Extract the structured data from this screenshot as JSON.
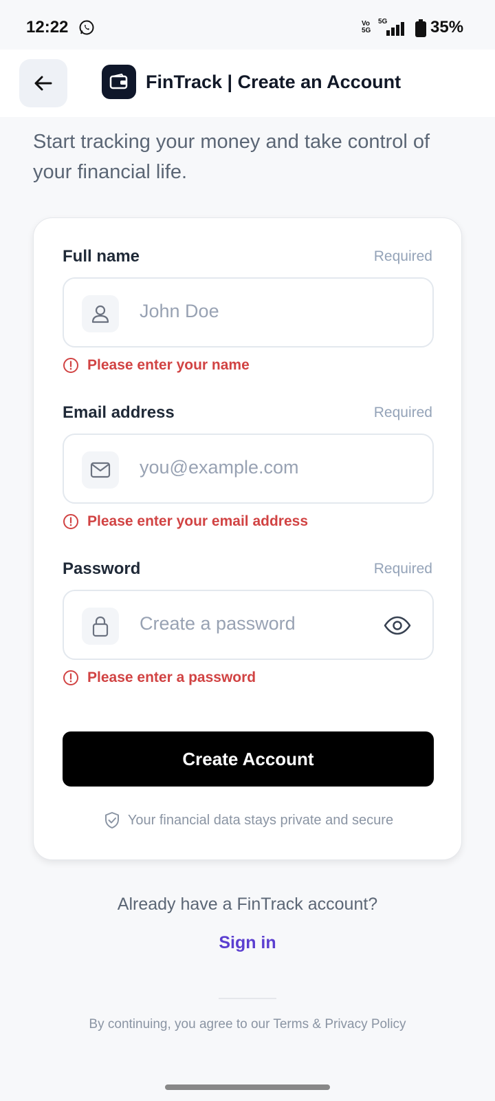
{
  "status_bar": {
    "time": "12:22",
    "network_label": "Vo 5G",
    "signal_label": "5G",
    "battery": "35%"
  },
  "header": {
    "title": "FinTrack | Create an Account"
  },
  "subtitle": "Start tracking your money and take control of your financial life.",
  "form": {
    "fields": [
      {
        "label": "Full name",
        "required": "Required",
        "placeholder": "John Doe",
        "icon": "user-icon",
        "error": "Please enter your name"
      },
      {
        "label": "Email address",
        "required": "Required",
        "placeholder": "you@example.com",
        "icon": "mail-icon",
        "error": "Please enter your email address"
      },
      {
        "label": "Password",
        "required": "Required",
        "placeholder": "Create a password",
        "icon": "lock-icon",
        "error": "Please enter a password"
      }
    ],
    "submit_label": "Create Account",
    "secure_note": "Your financial data stays private and secure"
  },
  "footer": {
    "already_text": "Already have a FinTrack account?",
    "signin_label": "Sign in",
    "terms_text": "By continuing, you agree to our Terms & Privacy Policy"
  },
  "colors": {
    "error": "#d14343",
    "link": "#5b3fd0",
    "button": "#000000",
    "logo_bg": "#0f172a"
  }
}
